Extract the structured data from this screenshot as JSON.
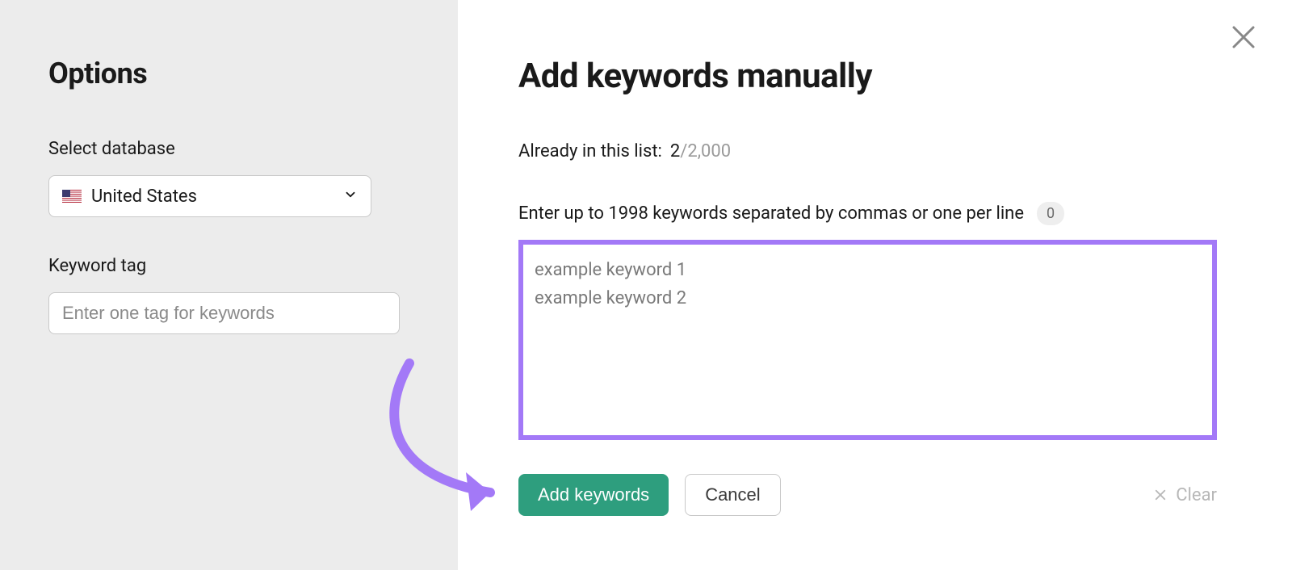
{
  "sidebar": {
    "title": "Options",
    "database_label": "Select database",
    "database_value": "United States",
    "tag_label": "Keyword tag",
    "tag_placeholder": "Enter one tag for keywords"
  },
  "main": {
    "title": "Add keywords manually",
    "already_label": "Already in this list:",
    "already_count": "2",
    "already_max": "/2,000",
    "enter_label": "Enter up to 1998 keywords separated by commas or one per line",
    "count_badge": "0",
    "textarea_placeholder": "example keyword 1\nexample keyword 2",
    "add_button": "Add keywords",
    "cancel_button": "Cancel",
    "clear_label": "Clear"
  }
}
